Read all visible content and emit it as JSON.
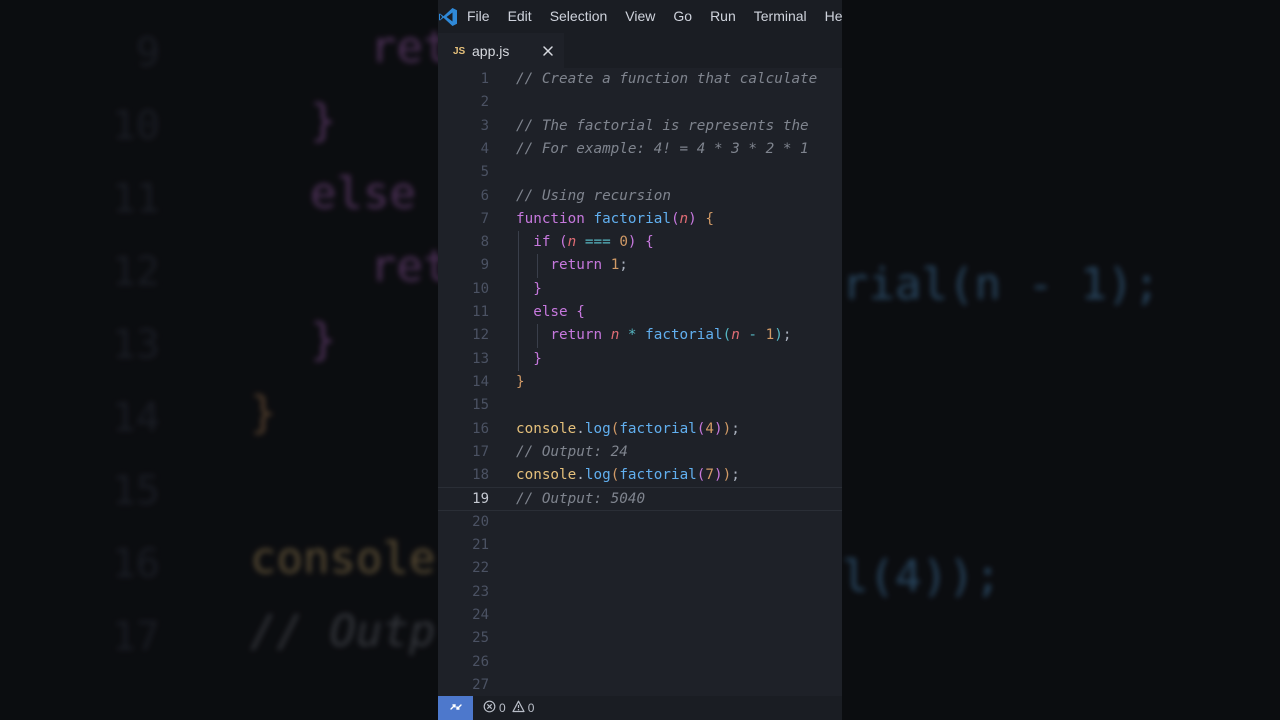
{
  "menu": [
    "File",
    "Edit",
    "Selection",
    "View",
    "Go",
    "Run",
    "Terminal",
    "Hel"
  ],
  "tab": {
    "badge": "JS",
    "label": "app.js"
  },
  "editor": {
    "current_line": 19,
    "line_numbers": [
      "1",
      "2",
      "3",
      "4",
      "5",
      "6",
      "7",
      "8",
      "9",
      "10",
      "11",
      "12",
      "13",
      "14",
      "15",
      "16",
      "17",
      "18",
      "19",
      "20",
      "21",
      "22",
      "23",
      "24",
      "25",
      "26",
      "27"
    ],
    "lines": [
      [
        {
          "t": "// Create a function that calculate",
          "c": "comment"
        }
      ],
      [],
      [
        {
          "t": "// The factorial is represents the ",
          "c": "comment"
        }
      ],
      [
        {
          "t": "// For example: 4! = 4 * 3 * 2 * 1",
          "c": "comment"
        }
      ],
      [],
      [
        {
          "t": "// Using recursion",
          "c": "comment"
        }
      ],
      [
        {
          "t": "function ",
          "c": "kw"
        },
        {
          "t": "factorial",
          "c": "fn"
        },
        {
          "t": "(",
          "c": "b2"
        },
        {
          "t": "n",
          "c": "param"
        },
        {
          "t": ")",
          "c": "b2"
        },
        {
          "t": " ",
          "c": "plain"
        },
        {
          "t": "{",
          "c": "b1"
        }
      ],
      [
        {
          "t": "  if ",
          "c": "kw"
        },
        {
          "t": "(",
          "c": "b2"
        },
        {
          "t": "n",
          "c": "param"
        },
        {
          "t": " === ",
          "c": "op"
        },
        {
          "t": "0",
          "c": "num"
        },
        {
          "t": ")",
          "c": "b2"
        },
        {
          "t": " {",
          "c": "b2"
        }
      ],
      [
        {
          "t": "    return ",
          "c": "kw"
        },
        {
          "t": "1",
          "c": "num"
        },
        {
          "t": ";",
          "c": "plain"
        }
      ],
      [
        {
          "t": "  }",
          "c": "b2"
        }
      ],
      [
        {
          "t": "  else ",
          "c": "kw"
        },
        {
          "t": "{",
          "c": "b2"
        }
      ],
      [
        {
          "t": "    return ",
          "c": "kw"
        },
        {
          "t": "n",
          "c": "param"
        },
        {
          "t": " * ",
          "c": "op"
        },
        {
          "t": "factorial",
          "c": "fn"
        },
        {
          "t": "(",
          "c": "b3"
        },
        {
          "t": "n",
          "c": "param"
        },
        {
          "t": " - ",
          "c": "op"
        },
        {
          "t": "1",
          "c": "num"
        },
        {
          "t": ")",
          "c": "b3"
        },
        {
          "t": ";",
          "c": "plain"
        }
      ],
      [
        {
          "t": "  }",
          "c": "b2"
        }
      ],
      [
        {
          "t": "}",
          "c": "b1"
        }
      ],
      [],
      [
        {
          "t": "console",
          "c": "obj"
        },
        {
          "t": ".",
          "c": "plain"
        },
        {
          "t": "log",
          "c": "fn"
        },
        {
          "t": "(",
          "c": "b1"
        },
        {
          "t": "factorial",
          "c": "fn"
        },
        {
          "t": "(",
          "c": "b2"
        },
        {
          "t": "4",
          "c": "num"
        },
        {
          "t": ")",
          "c": "b2"
        },
        {
          "t": ")",
          "c": "b1"
        },
        {
          "t": ";",
          "c": "plain"
        }
      ],
      [
        {
          "t": "// Output: 24",
          "c": "comment"
        }
      ],
      [
        {
          "t": "console",
          "c": "obj"
        },
        {
          "t": ".",
          "c": "plain"
        },
        {
          "t": "log",
          "c": "fn"
        },
        {
          "t": "(",
          "c": "b1"
        },
        {
          "t": "factorial",
          "c": "fn"
        },
        {
          "t": "(",
          "c": "b2"
        },
        {
          "t": "7",
          "c": "num"
        },
        {
          "t": ")",
          "c": "b2"
        },
        {
          "t": ")",
          "c": "b1"
        },
        {
          "t": ";",
          "c": "plain"
        }
      ],
      [
        {
          "t": "// Output: 5040",
          "c": "comment"
        }
      ],
      [],
      [],
      [],
      [],
      [],
      [],
      [],
      []
    ]
  },
  "statusbar": {
    "errors": "0",
    "warnings": "0"
  },
  "backdrop": {
    "lines": [
      {
        "n": "9",
        "code": "ret",
        "c": "kw"
      },
      {
        "n": "10",
        "code": "}",
        "c": "b2"
      },
      {
        "n": "11",
        "code": "else",
        "c": "kw"
      },
      {
        "n": "12",
        "code": "ret",
        "c": "kw"
      },
      {
        "n": "13",
        "code": "}",
        "c": "b2"
      },
      {
        "n": "14",
        "code": "}",
        "c": "b1"
      },
      {
        "n": "15",
        "code": "",
        "c": "plain"
      },
      {
        "n": "16",
        "code": "console",
        "c": "obj"
      },
      {
        "n": "17",
        "code": "// Outp",
        "c": "comment"
      }
    ],
    "right_fragments": [
      {
        "text": "rial(n - 1);",
        "c": "fn"
      },
      {
        "text": "l(4));",
        "c": "fn"
      }
    ]
  },
  "colors": {
    "accent": "#4d78cc",
    "editor_bg": "#1e2128",
    "chrome_bg": "#1a1d23"
  },
  "icons": {
    "logo": "vscode-logo-icon",
    "close": "close-icon",
    "remote": "remote-icon",
    "errors": "error-circle-icon",
    "warnings": "warning-triangle-icon"
  }
}
